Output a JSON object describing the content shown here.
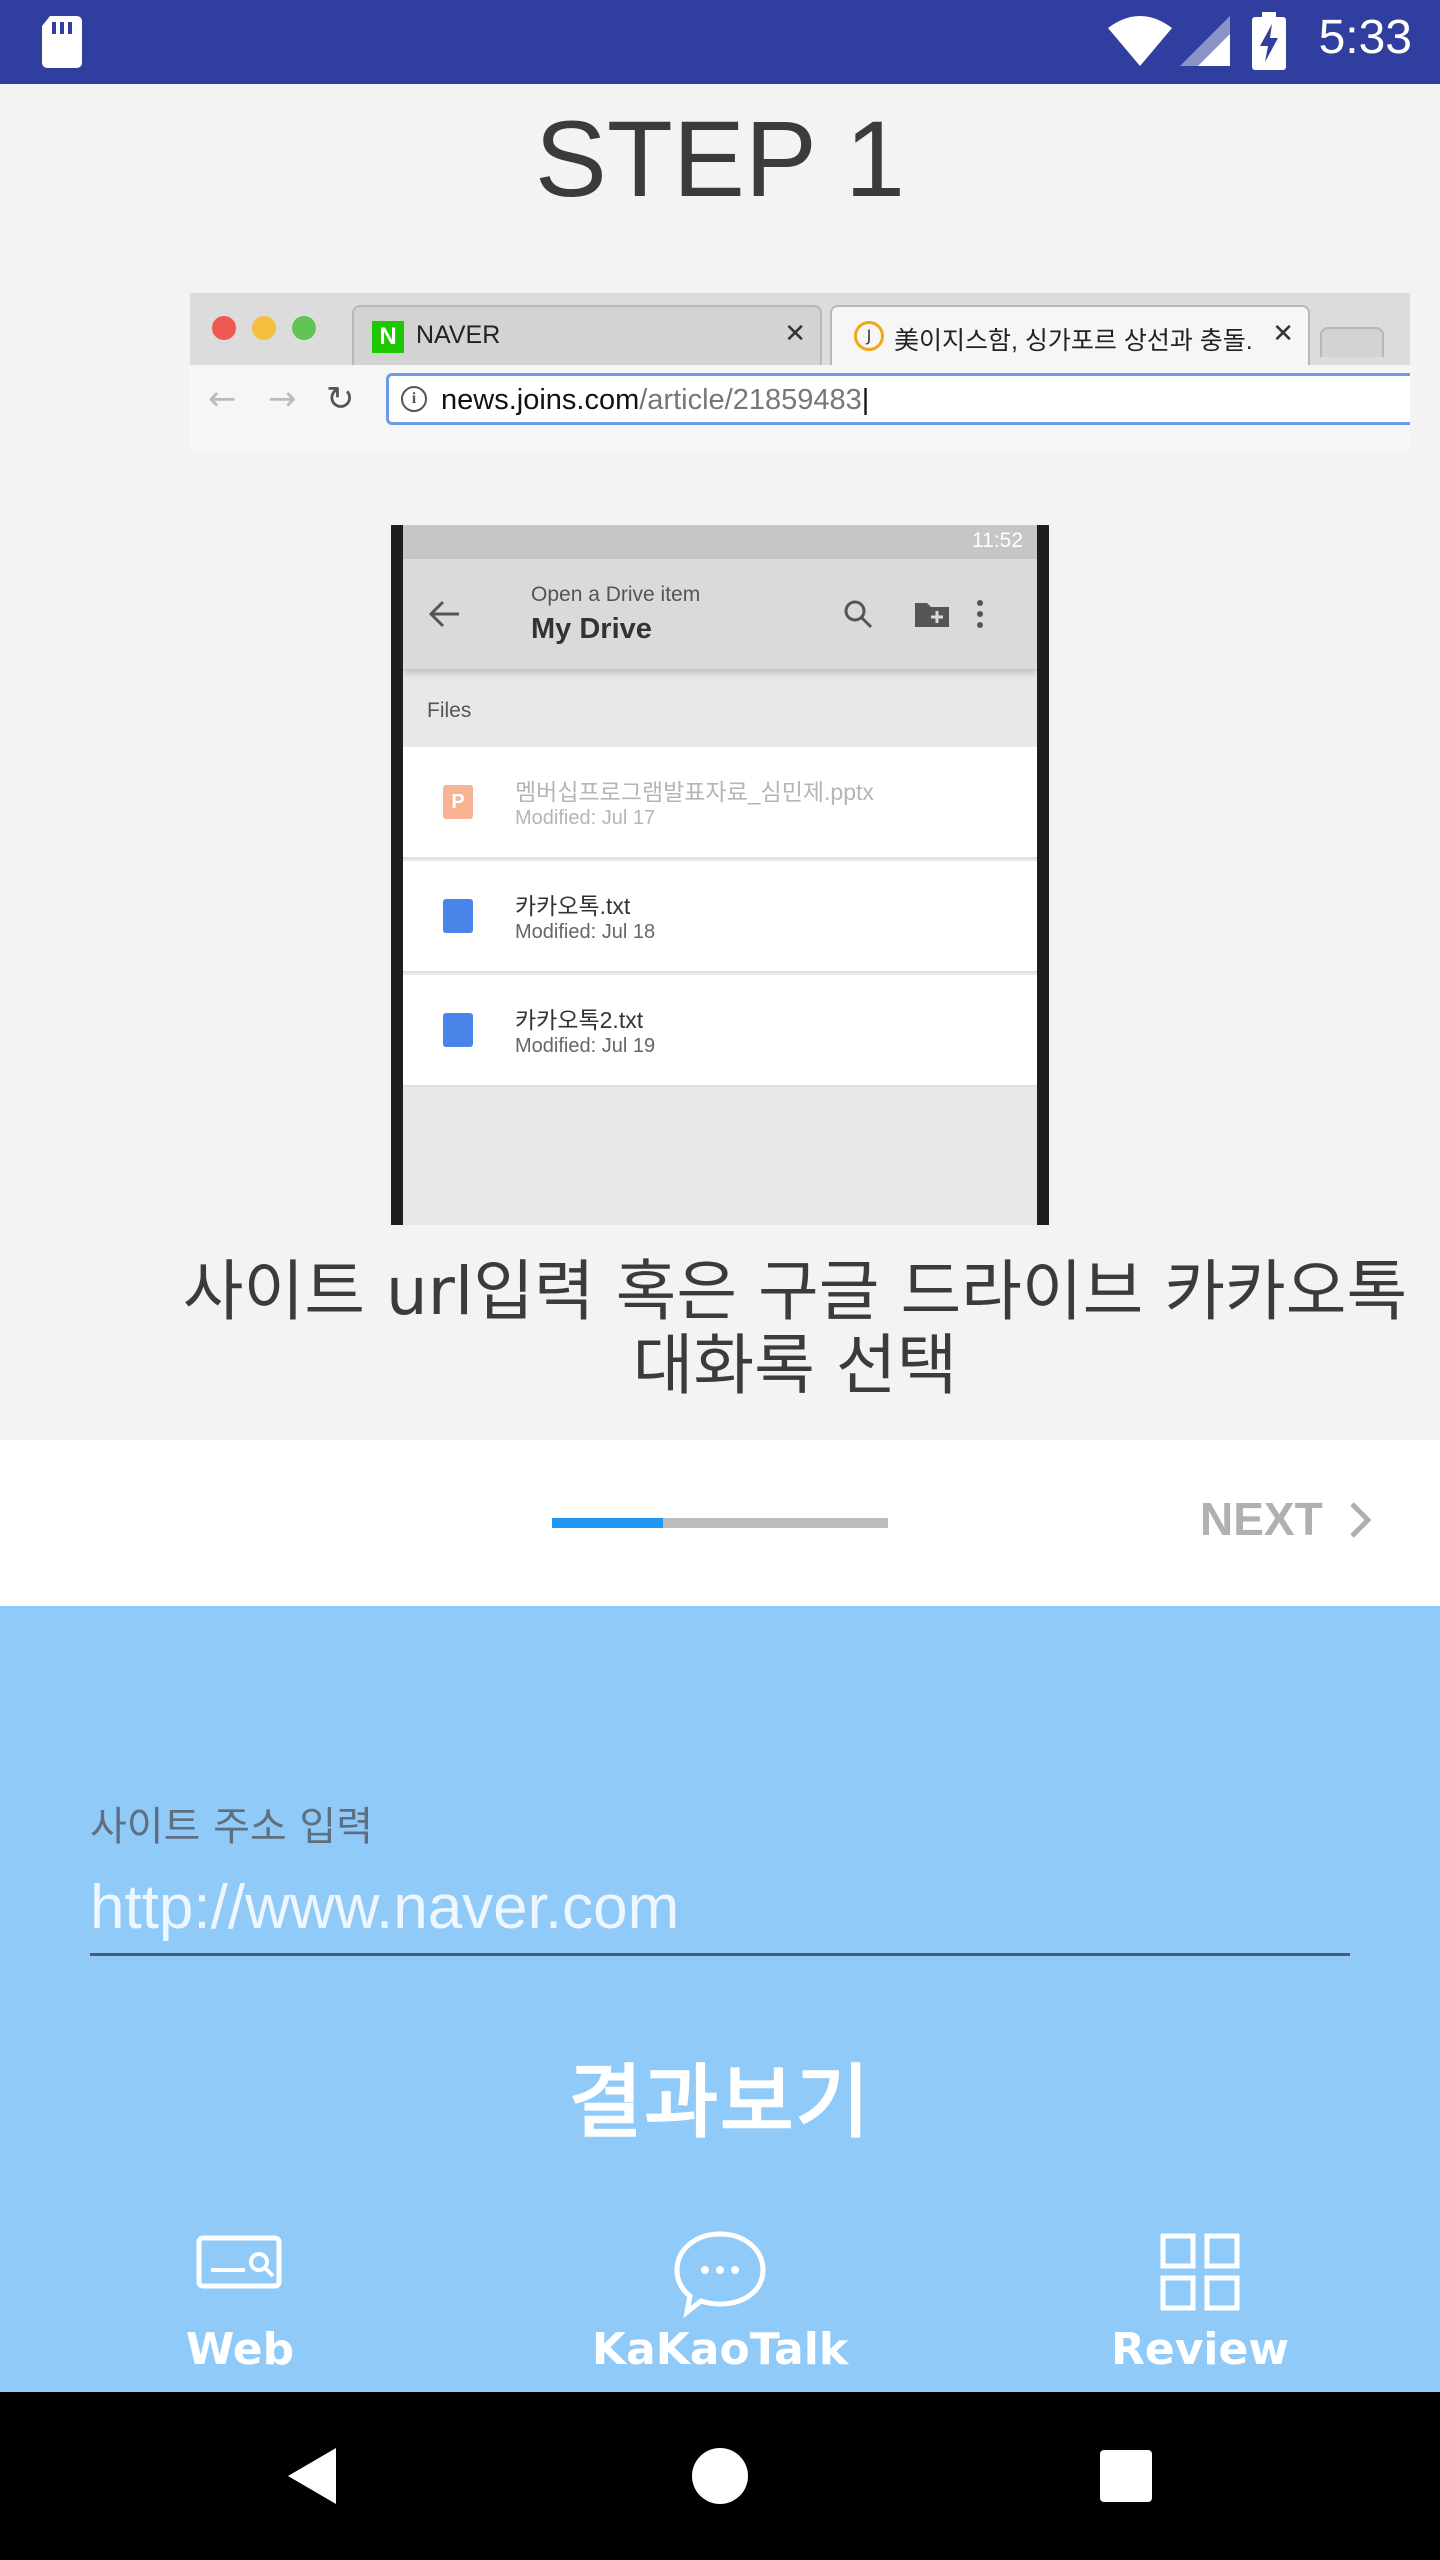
{
  "status_bar": {
    "time": "5:33"
  },
  "tutorial": {
    "step_title": "STEP 1",
    "caption_line1": "사이트 url입력 혹은 구글 드라이브 카카오톡",
    "caption_line2": "대화록 선택"
  },
  "browser_mock": {
    "tabs": [
      {
        "label": "NAVER"
      },
      {
        "label": "美이지스함, 싱가포르 상선과 충돌...1"
      }
    ],
    "url_host": "news.joins.com",
    "url_path": "/article/21859483"
  },
  "drive_mock": {
    "status_time": "11:52",
    "subtitle": "Open a Drive item",
    "title": "My Drive",
    "section": "Files",
    "files": [
      {
        "name": "멤버십프로그램발표자료_심민제.pptx",
        "modified": "Modified: Jul 17",
        "type": "pptx",
        "color": "#f4a07c"
      },
      {
        "name": "카카오톡.txt",
        "modified": "Modified: Jul 18",
        "type": "doc",
        "color": "#4a84e8"
      },
      {
        "name": "카카오톡2.txt",
        "modified": "Modified: Jul 19",
        "type": "doc",
        "color": "#4a84e8"
      }
    ]
  },
  "pager": {
    "next_label": "NEXT",
    "progress": 0.33
  },
  "form": {
    "label": "사이트 주소 입력",
    "placeholder": "http://www.naver.com",
    "value": "",
    "submit_label": "결과보기"
  },
  "bottom_nav": [
    {
      "label": "Web",
      "icon": "web-search-icon"
    },
    {
      "label": "KaKaoTalk",
      "icon": "chat-bubble-icon"
    },
    {
      "label": "Review",
      "icon": "grid-icon"
    }
  ],
  "colors": {
    "status_bar": "#303f9f",
    "panel": "#90caf9",
    "progress_fill": "#2196f3",
    "progress_track": "#bdbdbd"
  }
}
